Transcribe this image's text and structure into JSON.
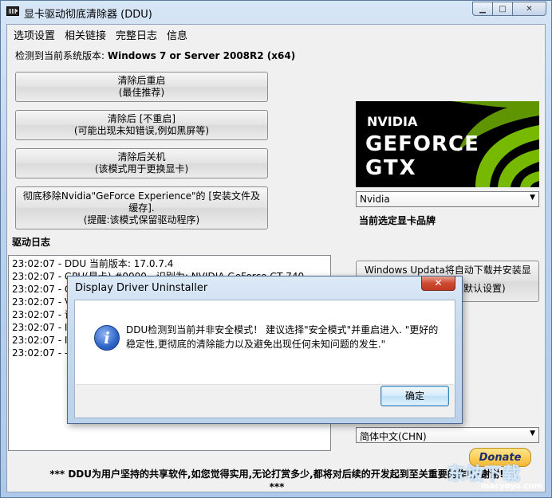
{
  "window": {
    "title": "显卡驱动彻底清除器 (DDU)"
  },
  "menu": [
    "选项设置",
    "相关链接",
    "完整日志",
    "信息"
  ],
  "os": {
    "prefix": "检测到当前系统版本: ",
    "value": "Windows 7 or Server 2008R2 (x64)"
  },
  "buttons": [
    {
      "line1": "清除后重启",
      "line2": "(最佳推荐)"
    },
    {
      "line1": "清除后 [不重启]",
      "line2": "(可能出现未知错误,例如黑屏等)"
    },
    {
      "line1": "清除后关机",
      "line2": "(该模式用于更换显卡)"
    },
    {
      "line1": "彻底移除Nvidia\"GeForce Experience\"的 [安装文件及缓存].",
      "line2": "(提醒:该模式保留驱动程序)"
    }
  ],
  "log": {
    "label": "驱动日志",
    "lines": [
      "23:02:07 - DDU 当前版本: 17.0.7.4",
      "23:02:07 - GPU(显卡) #0000 - 识别为: NVIDIA GeForce GT 740",
      "23:02:07 - GP",
      "23:02:07 - VI",
      "23:02:07 - 识",
      "23:02:07 - IN",
      "23:02:07 - IN",
      "23:02:07 - --"
    ]
  },
  "brand": {
    "logo_line1": "NVIDIA",
    "logo_line2": "GEFORCE",
    "logo_line3": "GTX",
    "selected": "Nvidia",
    "label": "当前选定显卡品牌"
  },
  "windows_update": {
    "line1": "Windows Updata将自动下载并安装显",
    "line2": "默认设置)"
  },
  "language": {
    "selected": "简体中文(CHN)"
  },
  "footer": {
    "line1": "*** DDU为用户坚持的共享软件,如您觉得实用,无论打赏多少,都将对后续的开发起到至关重要的作用!谢谢!",
    "line2": "***",
    "donate": "Donate"
  },
  "watermark": {
    "main": "东坡下载",
    "sub": "macyoyo.com"
  },
  "dialog": {
    "title": "Display Driver Uninstaller",
    "close": "✕",
    "message": "DDU检测到当前并非安全模式！ 建议选择\"安全模式\"并重启进入. \"更好的稳定性,更彻底的清除能力以及避免出现任何未知问题的发生.\"",
    "ok": "确定"
  },
  "colors": {
    "nvidia_green": "#76b900",
    "logo_bg": "#000000",
    "dialog_close": "#c23820"
  }
}
